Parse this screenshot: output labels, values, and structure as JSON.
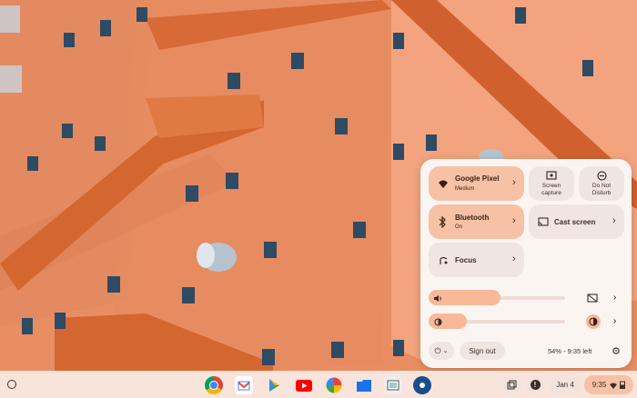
{
  "quick_settings": {
    "network": {
      "title": "Google Pixel",
      "subtitle": "Medium",
      "icon": "wifi-icon"
    },
    "screen_capture": {
      "label_line1": "Screen",
      "label_line2": "capture",
      "icon": "screen-capture-icon"
    },
    "do_not_disturb": {
      "label_line1": "Do Not",
      "label_line2": "Disturb",
      "icon": "do-not-disturb-icon"
    },
    "bluetooth": {
      "title": "Bluetooth",
      "subtitle": "On",
      "icon": "bluetooth-icon"
    },
    "cast": {
      "title": "Cast screen",
      "icon": "cast-icon"
    },
    "focus": {
      "title": "Focus",
      "icon": "focus-icon"
    },
    "volume_level": 0.4,
    "brightness_level": 0.2,
    "sign_out_label": "Sign out",
    "battery_text": "54% - 9:35 left"
  },
  "shelf": {
    "apps": [
      "chrome-icon",
      "gmail-icon",
      "play-store-icon",
      "youtube-icon",
      "photos-icon",
      "files-icon",
      "screenshot-app-icon",
      "settings-app-icon"
    ],
    "date": "Jan 4",
    "time": "9:35"
  },
  "colors": {
    "accent": "#f7c1a6",
    "panel": "#fbf5f2",
    "wall": "#e48b62"
  }
}
